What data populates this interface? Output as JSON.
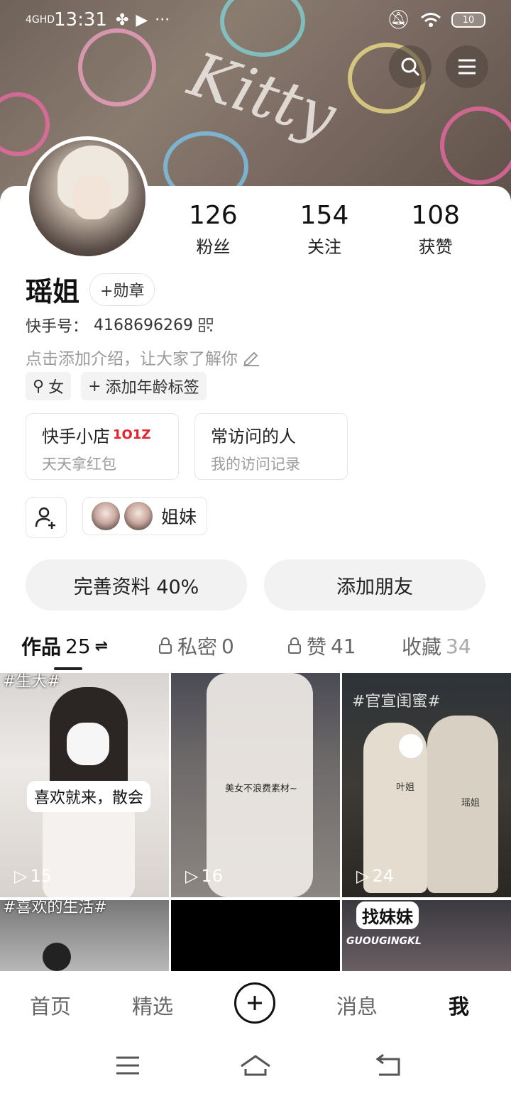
{
  "status_bar": {
    "network": "4GHD",
    "time": "13:31",
    "battery": "10"
  },
  "banner": {
    "text": "Kitty"
  },
  "profile": {
    "name": "瑶姐",
    "medal_button": "+勋章",
    "id_label": "快手号：",
    "id_value": "4168696269",
    "intro_placeholder": "点击添加介绍，让大家了解你",
    "gender_tag": "女",
    "age_tag": "添加年龄标签"
  },
  "stats": [
    {
      "value": "126",
      "label": "粉丝"
    },
    {
      "value": "154",
      "label": "关注"
    },
    {
      "value": "108",
      "label": "获赞"
    }
  ],
  "cards": {
    "shop_title": "快手小店",
    "shop_badge": "1O1Z",
    "shop_sub": "天天拿红包",
    "visitors_title": "常访问的人",
    "visitors_sub": "我的访问记录"
  },
  "social": {
    "sisters_label": "姐妹"
  },
  "actions": {
    "complete_profile": "完善资料 40%",
    "add_friend": "添加朋友"
  },
  "tabs": [
    {
      "label": "作品",
      "count": "25",
      "extra": "⇌"
    },
    {
      "label": "私密",
      "count": "0"
    },
    {
      "label": "赞",
      "count": "41"
    },
    {
      "label": "收藏",
      "count": "34"
    }
  ],
  "grid": [
    {
      "views": "15",
      "top_caption": "#生大#",
      "bubble": "喜欢就来，散会"
    },
    {
      "views": "16",
      "overlay": "美女不浪费素材~"
    },
    {
      "views": "24",
      "top_caption": "#官宣闺蜜#",
      "name1": "叶姐",
      "name2": "瑶姐"
    },
    {
      "top_caption": "#喜欢的生活#"
    },
    {},
    {
      "top_caption": "找妹妹",
      "sub_caption": "GUOUGINGKL"
    }
  ],
  "bottom_nav": {
    "home": "首页",
    "featured": "精选",
    "messages": "消息",
    "me": "我"
  },
  "colors": {
    "accent_red": "#e8222d",
    "text_dark": "#111111",
    "muted": "#9a9a9a"
  }
}
